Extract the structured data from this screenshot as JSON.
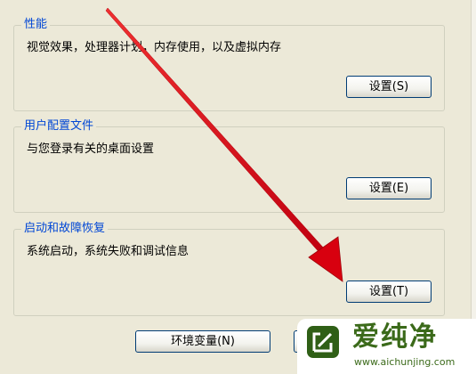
{
  "performance": {
    "legend": "性能",
    "description": "视觉效果，处理器计划，内存使用，以及虚拟内存",
    "button": "设置(S)"
  },
  "user_profiles": {
    "legend": "用户配置文件",
    "description": "与您登录有关的桌面设置",
    "button": "设置(E)"
  },
  "startup_recovery": {
    "legend": "启动和故障恢复",
    "description": "系统启动，系统失败和调试信息",
    "button": "设置(T)"
  },
  "footer": {
    "env_button": "环境变量(N)"
  },
  "watermark": {
    "title": "爱纯净",
    "url": "www.aichunjing.com",
    "color": "#3b6a1a"
  },
  "annotation": {
    "arrow_color": "#d8000f",
    "target": "设置(T)"
  }
}
